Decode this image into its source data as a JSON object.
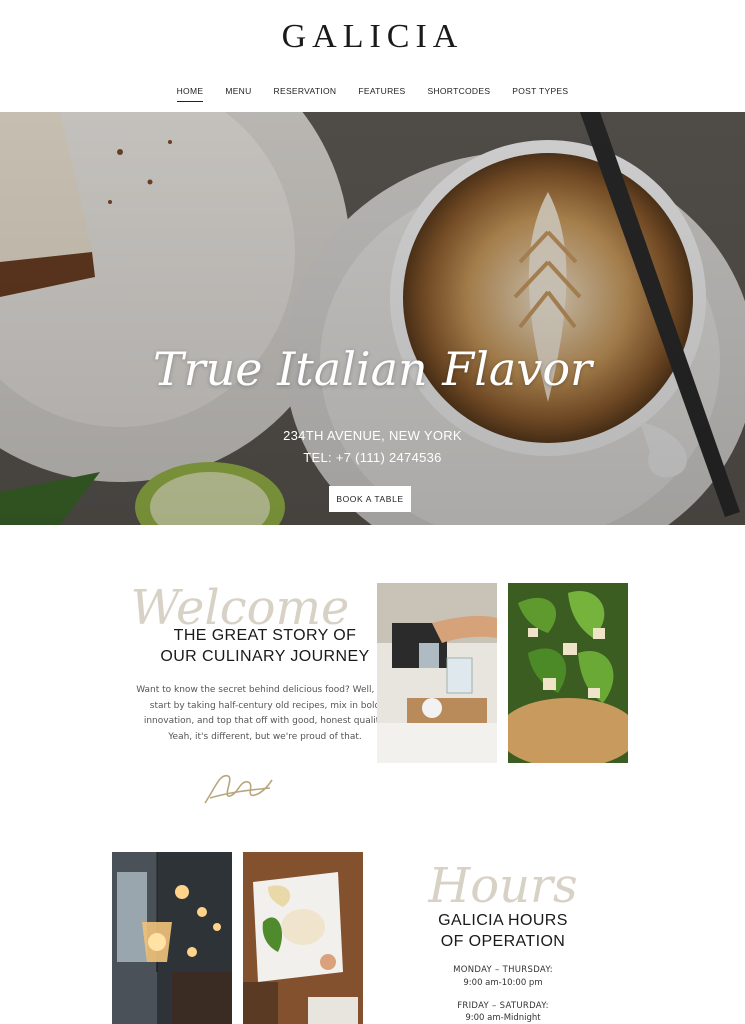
{
  "header": {
    "logo": "GALICIA",
    "nav": [
      "HOME",
      "MENU",
      "RESERVATION",
      "FEATURES",
      "SHORTCODES",
      "POST TYPES"
    ]
  },
  "hero": {
    "title": "True Italian Flavor",
    "address": "234TH AVENUE, NEW YORK",
    "tel": "TEL: +7 (111) 2474536",
    "button": "BOOK A TABLE"
  },
  "story": {
    "script": "Welcome",
    "heading_line1": "THE GREAT STORY OF",
    "heading_line2": "OUR CULINARY JOURNEY",
    "text": "Want to know the secret behind delicious food? Well, you start by taking half-century old recipes, mix in bold innovation, and top that off with good, honest quality. Yeah, it's different, but we're proud of that."
  },
  "hours": {
    "script": "Hours",
    "heading_line1": "GALICIA HOURS",
    "heading_line2": "OF OPERATION",
    "schedule": [
      {
        "days": "MONDAY – THURSDAY:",
        "time": "9:00 am-10:00 pm"
      },
      {
        "days": "FRIDAY – SATURDAY:",
        "time": "9:00 am-Midnight"
      }
    ]
  },
  "colors": {
    "accent_gold": "#b9a67d",
    "text_dark": "#1a1a1a"
  }
}
